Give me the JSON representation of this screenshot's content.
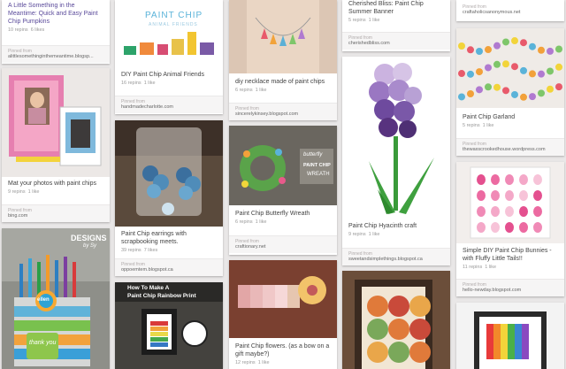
{
  "pins": [
    {
      "desc": "A Little Something in the Meantime: Quick and Easy Paint Chip Pumpkins",
      "repins": "10 repins",
      "likes": "6 likes",
      "source_label": "Pinned from",
      "source": "alittlesomethinginthemeantime.blogsp..."
    },
    {
      "desc": "DIY Paint Chip Animal Friends",
      "repins": "16 repins",
      "likes": "1 like",
      "source_label": "Pinned from",
      "source": "handmadecharlotte.com",
      "logo": "PAINT CHIP",
      "logo_sub": "ANIMAL FRIENDS"
    },
    {
      "desc": "diy necklace made of paint chips",
      "repins": "6 repins",
      "likes": "1 like",
      "source_label": "Pinned from",
      "source": "sincerelykinsey.blogspot.com"
    },
    {
      "desc": "Cherished Bliss: Paint Chip Summer Banner",
      "repins": "5 repins",
      "likes": "1 like",
      "source_label": "Pinned from",
      "source": "cherishedbliss.com"
    },
    {
      "source_label": "Pinned from",
      "source": "craftaholicsanonymous.net"
    },
    {
      "desc": "Mat your photos with paint chips",
      "repins": "9 repins",
      "likes": "1 like",
      "source_label": "Pinned from",
      "source": "bing.com"
    },
    {
      "desc": "Paint Chip earrings with scrapbooking meets.",
      "repins": "39 repins",
      "likes": "7 likes",
      "source_label": "Pinned from",
      "source": "oppoemtem.blogspot.ca"
    },
    {
      "desc": "Paint Chip Butterfly Wreath",
      "repins": "6 repins",
      "likes": "1 like",
      "source_label": "Pinned from",
      "source": "craftionary.net",
      "overlay1": "butterfly",
      "overlay2": "PAINT CHIP",
      "overlay3": "WREATH"
    },
    {
      "desc": "Paint Chip Hyacinth craft",
      "repins": "9 repins",
      "likes": "1 like",
      "source_label": "Pinned from",
      "source": "sweetandsimplethings.blogspot.ca"
    },
    {
      "desc": "Paint Chip Garland",
      "repins": "5 repins",
      "likes": "1 like",
      "source_label": "Pinned from",
      "source": "thewaxscrookedhouse.wordpress.com"
    },
    {
      "desc": "Simple DIY Paint Chip Bunnies - with Fluffy Little Tails!!",
      "repins": "11 repins",
      "likes": "1 like",
      "source_label": "Pinned from",
      "source": "hello-newday.blogspot.com"
    },
    {
      "overlay1": "DESIGNS",
      "overlay2": "by Sy",
      "tag1": "thank you",
      "tag2": "ellen"
    },
    {
      "overlay1": "How To Make A",
      "overlay2": "Paint Chip Rainbow Print"
    },
    {
      "desc": "Paint Chip flowers. (as a bow on a gift maybe?)",
      "repins": "12 repins",
      "likes": "1 like"
    }
  ]
}
